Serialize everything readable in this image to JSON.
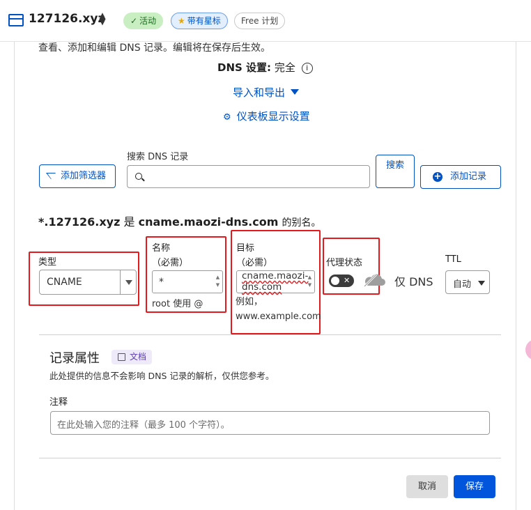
{
  "header": {
    "domain": "127126.xyz",
    "badges": {
      "active": "活动",
      "starred": "带有星标",
      "plan": "Free 计划"
    }
  },
  "intro": "查看、添加和编辑 DNS 记录。编辑将在保存后生效。",
  "dns_setting": {
    "label": "DNS 设置:",
    "value": "完全"
  },
  "links": {
    "import_export": "导入和导出",
    "dashboard_settings": "仪表板显示设置"
  },
  "toolbar": {
    "add_filter": "添加筛选器",
    "search_label": "搜索 DNS 记录",
    "search_value": "",
    "search_button": "搜索",
    "add_record": "添加记录"
  },
  "alias_line": {
    "record": "*.127126.xyz",
    "is": "是",
    "target": "cname.maozi-dns.com",
    "suffix": "的别名。"
  },
  "form": {
    "type_label": "类型",
    "type_value": "CNAME",
    "name_label": "名称",
    "name_required": "（必需）",
    "name_value": "*",
    "name_helper": "root 使用 @",
    "target_label": "目标",
    "target_required": "（必需）",
    "target_value": "cname.maozi-dns.com",
    "target_helper": "例如，www.example.com",
    "proxy_label": "代理状态",
    "proxy_value": "仅 DNS",
    "ttl_label": "TTL",
    "ttl_value": "自动"
  },
  "record_attributes": {
    "title": "记录属性",
    "doc_badge": "文档",
    "description": "此处提供的信息不会影响 DNS 记录的解析，仅供您参考。",
    "note_label": "注释",
    "note_placeholder": "在此处输入您的注释（最多 100 个字符）。"
  },
  "actions": {
    "cancel": "取消",
    "save": "保存"
  },
  "colors": {
    "accent": "#0051c3",
    "highlight_box": "#e3191d",
    "save_button": "#0055dc"
  }
}
